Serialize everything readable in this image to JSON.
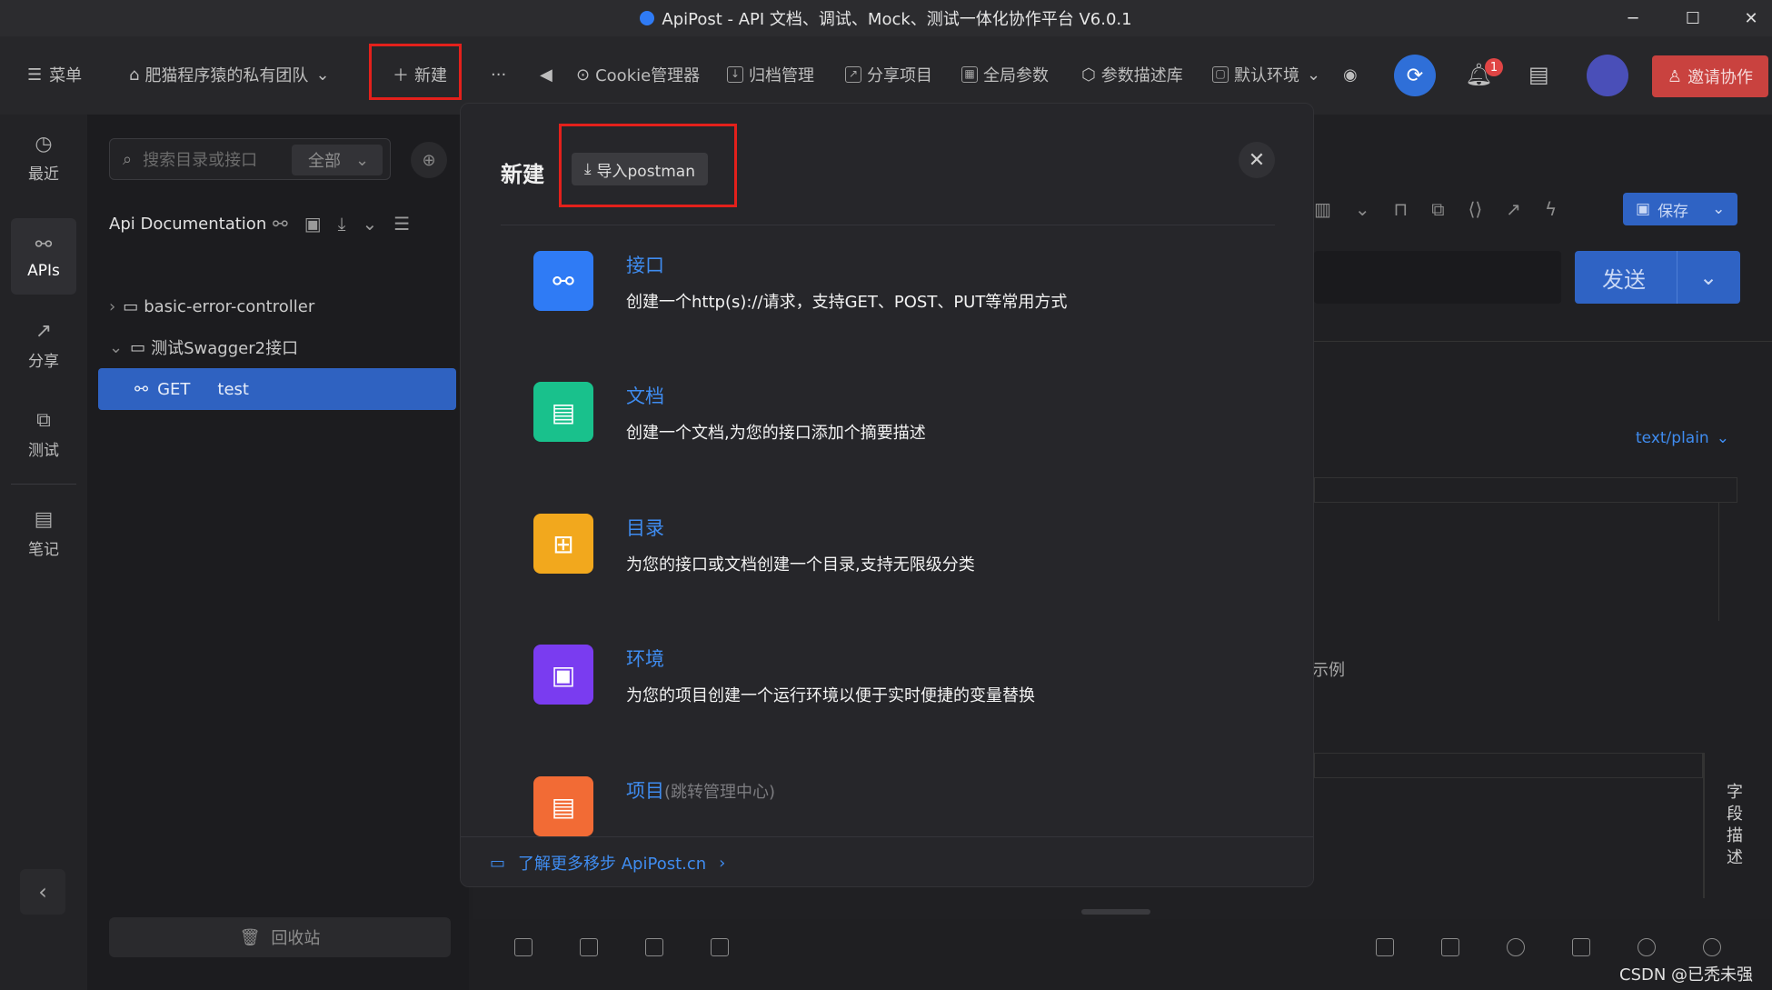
{
  "window": {
    "title": "ApiPost - API 文档、调试、Mock、测试一体化协作平台 V6.0.1",
    "minimize": "─",
    "maximize": "☐",
    "close": "✕"
  },
  "toolbar": {
    "menu": "菜单",
    "team": "肥猫程序猿的私有团队",
    "new": "新建",
    "more": "···",
    "cookie": "Cookie管理器",
    "archive": "归档管理",
    "share": "分享项目",
    "global_params": "全局参数",
    "param_lib": "参数描述库",
    "env": "默认环境",
    "notif_count": "1",
    "invite": "邀请协作"
  },
  "leftnav": {
    "recent": "最近",
    "apis": "APIs",
    "share": "分享",
    "test": "测试",
    "notes": "笔记"
  },
  "sidebar": {
    "search_placeholder": "搜索目录或接口",
    "filter": "全部",
    "project": "Api Documentation",
    "tree": [
      {
        "label": "basic-error-controller"
      },
      {
        "label": "测试Swagger2接口"
      }
    ],
    "selected": {
      "method": "GET",
      "name": "test"
    },
    "recycle": "回收站"
  },
  "right": {
    "save": "保存",
    "send": "发送",
    "content_type": "text/plain",
    "example": "示例",
    "field_desc": "字段描述"
  },
  "dialog": {
    "title": "新建",
    "import": "导入postman",
    "options": [
      {
        "title": "接口",
        "desc": "创建一个http(s)://请求，支持GET、POST、PUT等常用方式",
        "color": "#2f7bf5"
      },
      {
        "title": "文档",
        "desc": "创建一个文档,为您的接口添加个摘要描述",
        "color": "#19c18c"
      },
      {
        "title": "目录",
        "desc": "为您的接口或文档创建一个目录,支持无限级分类",
        "color": "#f2a81d"
      },
      {
        "title": "环境",
        "desc": "为您的项目创建一个运行环境以便于实时便捷的变量替换",
        "color": "#7a3cf0"
      },
      {
        "title": "项目",
        "sub": "(跳转管理中心)",
        "color": "#f26b35"
      }
    ],
    "footer": "了解更多移步 ApiPost.cn"
  },
  "watermark": "CSDN @已秃未强"
}
